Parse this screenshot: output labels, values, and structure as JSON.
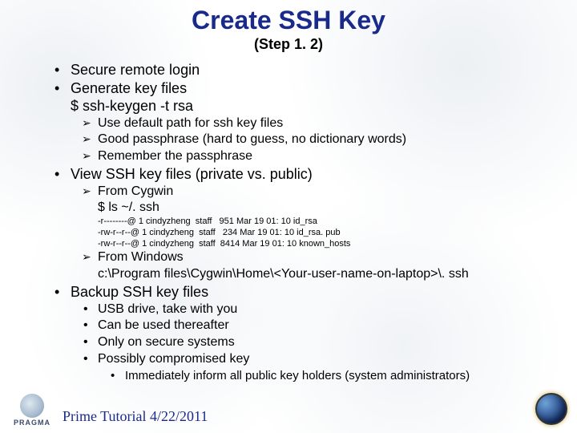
{
  "title": "Create SSH Key",
  "subtitle": "(Step 1. 2)",
  "bullets": {
    "b1": "Secure remote login",
    "b2": "Generate key files",
    "b2_cmd": "$ ssh-keygen -t rsa",
    "b2_sub1": "Use default path for ssh key files",
    "b2_sub2": "Good passphrase (hard to guess, no dictionary words)",
    "b2_sub3": "Remember the passphrase",
    "b3": "View SSH key files (private vs. public)",
    "b3_sub1": "From Cygwin",
    "b3_sub1_cmd": "$ ls ~/. ssh",
    "b3_ls1": "-r--------@ 1 cindyzheng  staff   951 Mar 19 01: 10 id_rsa",
    "b3_ls2": "-rw-r--r--@ 1 cindyzheng  staff   234 Mar 19 01: 10 id_rsa. pub",
    "b3_ls3": "-rw-r--r--@ 1 cindyzheng  staff  8414 Mar 19 01: 10 known_hosts",
    "b3_sub2": "From Windows",
    "b3_sub2_path": "c:\\Program files\\Cygwin\\Home\\<Your-user-name-on-laptop>\\. ssh",
    "b4": "Backup SSH key files",
    "b4_sub1": "USB drive, take with you",
    "b4_sub2": "Can be used thereafter",
    "b4_sub3": "Only on secure systems",
    "b4_sub4": "Possibly compromised key",
    "b4_sub4_sub1": "Immediately inform all public key holders (system administrators)"
  },
  "footer": "Prime Tutorial 4/22/2011",
  "logos": {
    "left_text": "PRAGMA"
  }
}
